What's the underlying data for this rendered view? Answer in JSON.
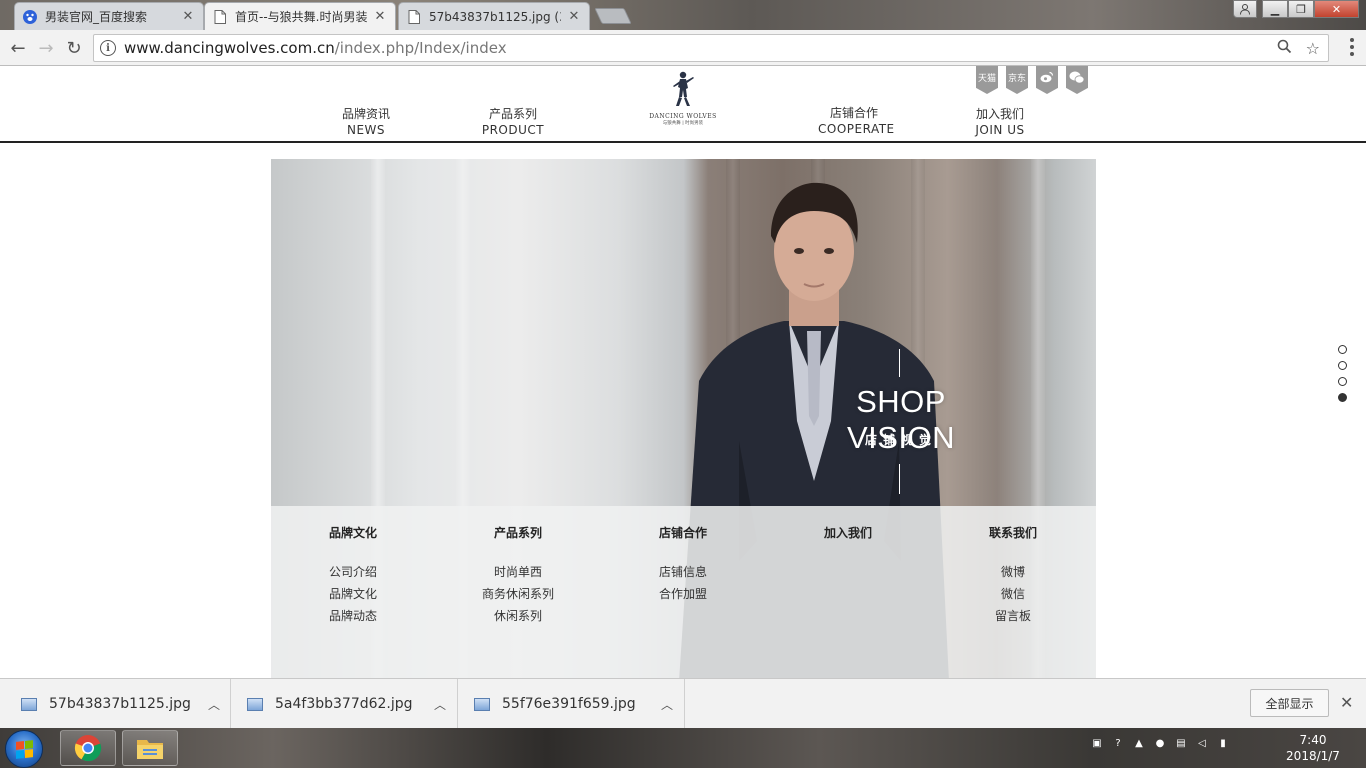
{
  "browser": {
    "tabs": [
      {
        "title": "男装官网_百度搜索",
        "icon": "baidu-paw-icon",
        "active": false
      },
      {
        "title": "首页--与狼共舞.时尚男装",
        "icon": "page-icon",
        "active": true
      },
      {
        "title": "57b43837b1125.jpg (3",
        "icon": "page-icon",
        "active": false
      }
    ],
    "url_host": "www.dancingwolves.com.cn",
    "url_path": "/index.php/Index/index"
  },
  "site": {
    "nav": {
      "news": {
        "zh": "品牌资讯",
        "en": "NEWS"
      },
      "product": {
        "zh": "产品系列",
        "en": "PRODUCT"
      },
      "cooperate": {
        "zh": "店铺合作",
        "en": "COOPERATE"
      },
      "join": {
        "zh": "加入我们",
        "en": "JOIN US"
      }
    },
    "logo": {
      "brand": "DANCING WOLVES",
      "brand_cn": "与狼共舞 | 时尚男装"
    },
    "social": [
      "天猫",
      "京东",
      "weibo-icon",
      "wechat-icon"
    ],
    "hero": {
      "title": "SHOP VISION",
      "subtitle": "店铺视觉"
    },
    "footer": {
      "brand": {
        "heading": "品牌文化",
        "links": [
          "公司介绍",
          "品牌文化",
          "品牌动态"
        ]
      },
      "products": {
        "heading": "产品系列",
        "links": [
          "时尚单西",
          "商务休闲系列",
          "休闲系列"
        ]
      },
      "stores": {
        "heading": "店铺合作",
        "links": [
          "店铺信息",
          "合作加盟"
        ]
      },
      "join": {
        "heading": "加入我们",
        "links": []
      },
      "contact": {
        "heading": "联系我们",
        "links": [
          "微博",
          "微信",
          "留言板"
        ]
      }
    },
    "slide_dots": {
      "count": 4,
      "active_index": 3
    }
  },
  "downloads": {
    "items": [
      "57b43837b1125.jpg",
      "5a4f3bb377d62.jpg",
      "55f76e391f659.jpg"
    ],
    "show_all": "全部显示"
  },
  "taskbar": {
    "time": "7:40",
    "date": "2018/1/7"
  }
}
